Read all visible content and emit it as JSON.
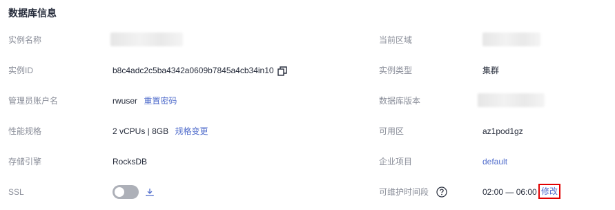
{
  "section_title": "数据库信息",
  "left": {
    "instance_name": {
      "label": "实例名称",
      "value": ""
    },
    "instance_id": {
      "label": "实例ID",
      "value": "b8c4adc2c5ba4342a0609b7845a4cb34in10",
      "icon": "copy-icon"
    },
    "admin_account": {
      "label": "管理员账户名",
      "value": "rwuser",
      "action": "重置密码"
    },
    "spec": {
      "label": "性能规格",
      "value": "2 vCPUs | 8GB",
      "action": "规格变更"
    },
    "storage_engine": {
      "label": "存储引擎",
      "value": "RocksDB"
    },
    "ssl": {
      "label": "SSL",
      "enabled": false,
      "icon": "download-icon"
    }
  },
  "right": {
    "region": {
      "label": "当前区域",
      "value": ""
    },
    "instance_type": {
      "label": "实例类型",
      "value": "集群"
    },
    "db_version": {
      "label": "数据库版本",
      "value": ""
    },
    "az": {
      "label": "可用区",
      "value": "az1pod1gz"
    },
    "enterprise_project": {
      "label": "企业项目",
      "value": "default"
    },
    "maintenance": {
      "label": "可维护时间段",
      "value": "02:00 — 06:00",
      "action": "修改",
      "icon": "help-icon"
    }
  },
  "colors": {
    "link": "#526ecc",
    "label": "#8a8e99",
    "text": "#252b3a",
    "highlight": "#e10000"
  }
}
